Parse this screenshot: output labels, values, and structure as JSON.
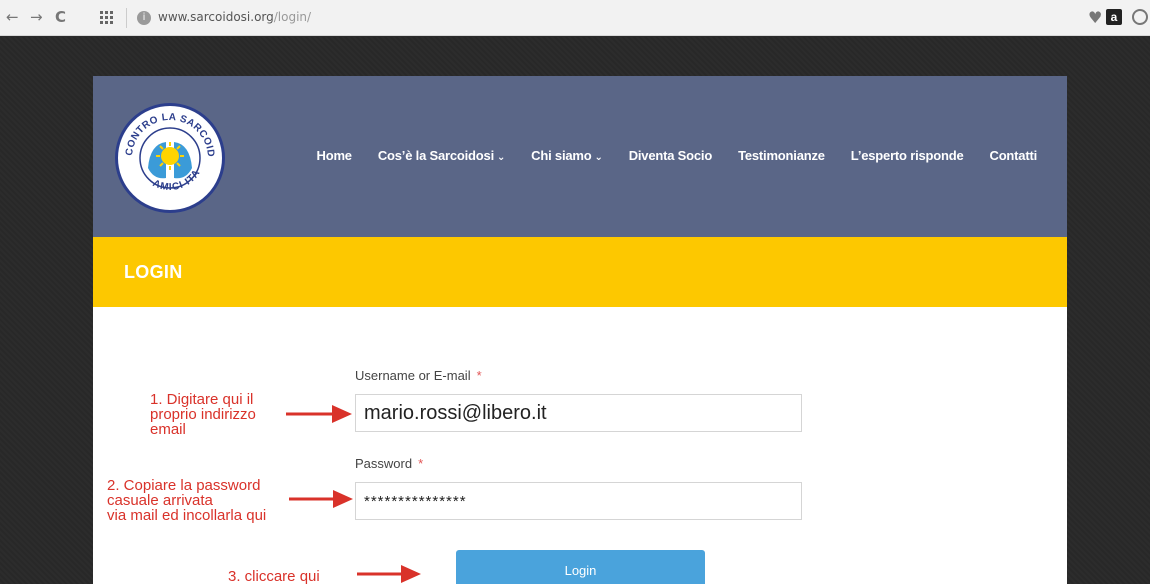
{
  "browser": {
    "url_domain": "www.sarcoidosi.org",
    "url_path": "/login/"
  },
  "logo": {
    "text_top": "CONTRO LA SARCOIDOSI",
    "text_bottom": "AMICI ITALIA"
  },
  "menu": {
    "items": [
      {
        "label": "Home"
      },
      {
        "label": "Cos’è la Sarcoidosi"
      },
      {
        "label": "Chi siamo"
      },
      {
        "label": "Diventa Socio"
      },
      {
        "label": "Testimonianze"
      },
      {
        "label": "L’esperto risponde"
      },
      {
        "label": "Contatti"
      }
    ]
  },
  "page": {
    "title": "LOGIN"
  },
  "form": {
    "username_label": "Username or E-mail",
    "username_value": "mario.rossi@libero.it",
    "password_label": "Password",
    "password_value": "***************",
    "required_mark": "*",
    "login_label": "Login"
  },
  "annotations": {
    "step1": [
      "1. Digitare qui il",
      "proprio indirizzo",
      "email"
    ],
    "step2": [
      "2. Copiare la password",
      "casuale arrivata",
      "via mail ed incollarla qui"
    ],
    "step3": [
      "3. cliccare qui"
    ]
  },
  "colors": {
    "header_bg": "#5a6687",
    "title_bar_bg": "#fdc800",
    "button_bg": "#4aa3dc",
    "annotation": "#d9322a"
  }
}
